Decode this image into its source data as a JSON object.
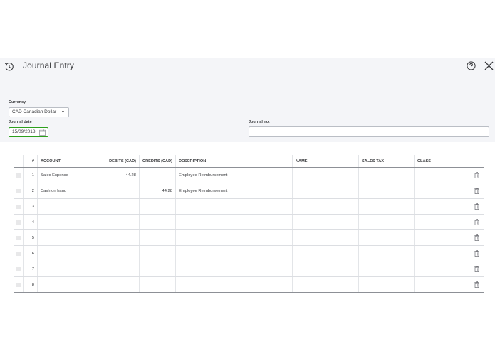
{
  "dialog": {
    "title": "Journal Entry"
  },
  "form": {
    "currency_label": "Currency",
    "currency_value": "CAD Canadian Dollar",
    "journal_date_label": "Journal date",
    "journal_date_value": "15/09/2018",
    "journal_no_label": "Journal no.",
    "journal_no_value": ""
  },
  "table": {
    "headers": {
      "index": "#",
      "account": "ACCOUNT",
      "debits": "DEBITS (CAD)",
      "credits": "CREDITS (CAD)",
      "description": "DESCRIPTION",
      "name": "NAME",
      "sales_tax": "SALES TAX",
      "class": "CLASS"
    },
    "rows": [
      {
        "index": "1",
        "account": "Sales Expense",
        "debits": "44.28",
        "credits": "",
        "description": "Employee Reimbursement",
        "name": "",
        "sales_tax": "",
        "class": ""
      },
      {
        "index": "2",
        "account": "Cash on hand",
        "debits": "",
        "credits": "44.28",
        "description": "Employee Reimbursement",
        "name": "",
        "sales_tax": "",
        "class": ""
      },
      {
        "index": "3",
        "account": "",
        "debits": "",
        "credits": "",
        "description": "",
        "name": "",
        "sales_tax": "",
        "class": ""
      },
      {
        "index": "4",
        "account": "",
        "debits": "",
        "credits": "",
        "description": "",
        "name": "",
        "sales_tax": "",
        "class": ""
      },
      {
        "index": "5",
        "account": "",
        "debits": "",
        "credits": "",
        "description": "",
        "name": "",
        "sales_tax": "",
        "class": ""
      },
      {
        "index": "6",
        "account": "",
        "debits": "",
        "credits": "",
        "description": "",
        "name": "",
        "sales_tax": "",
        "class": ""
      },
      {
        "index": "7",
        "account": "",
        "debits": "",
        "credits": "",
        "description": "",
        "name": "",
        "sales_tax": "",
        "class": ""
      },
      {
        "index": "8",
        "account": "",
        "debits": "",
        "credits": "",
        "description": "",
        "name": "",
        "sales_tax": "",
        "class": ""
      }
    ]
  },
  "icons": {
    "history": "history-icon",
    "help": "help-icon",
    "close": "close-icon",
    "calendar": "calendar-icon",
    "drag": "drag-handle-icon",
    "delete": "trash-icon"
  },
  "colors": {
    "header_bg": "#f4f5f8",
    "active_border": "#2ca01c",
    "text": "#393a3d"
  }
}
